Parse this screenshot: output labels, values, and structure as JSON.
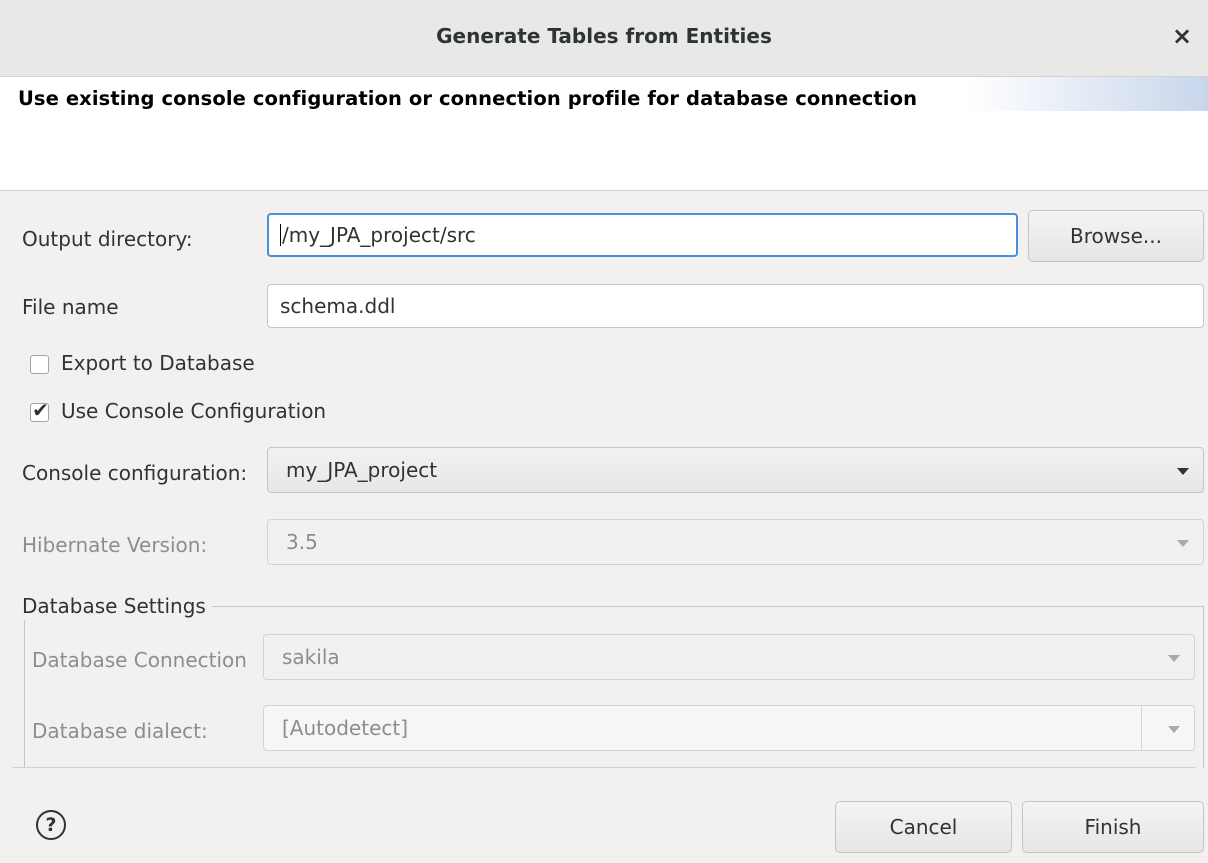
{
  "dialog": {
    "title": "Generate Tables from Entities",
    "close_glyph": "×"
  },
  "banner": {
    "text": "Use existing console configuration or connection profile for database connection"
  },
  "form": {
    "output_directory": {
      "label": "Output directory:",
      "value": "/my_JPA_project/src",
      "browse_label": "Browse..."
    },
    "file_name": {
      "label": "File name",
      "value": "schema.ddl"
    },
    "export_to_database": {
      "label": "Export to Database",
      "checked": false
    },
    "use_console_configuration": {
      "label": "Use Console Configuration",
      "checked": true,
      "check_glyph": "✔"
    },
    "console_configuration": {
      "label": "Console configuration:",
      "value": "my_JPA_project"
    },
    "hibernate_version": {
      "label": "Hibernate Version:",
      "value": "3.5"
    },
    "database_settings": {
      "legend": "Database Settings",
      "database_connection": {
        "label": "Database Connection",
        "value": "sakila"
      },
      "database_dialect": {
        "label": "Database dialect:",
        "value": "[Autodetect]"
      }
    }
  },
  "footer": {
    "help_glyph": "?",
    "cancel_label": "Cancel",
    "finish_label": "Finish"
  },
  "colors": {
    "focus_border": "#4a90d9",
    "disabled_text": "#8b8e8f",
    "banner_gradient": "#c8d6ec"
  }
}
